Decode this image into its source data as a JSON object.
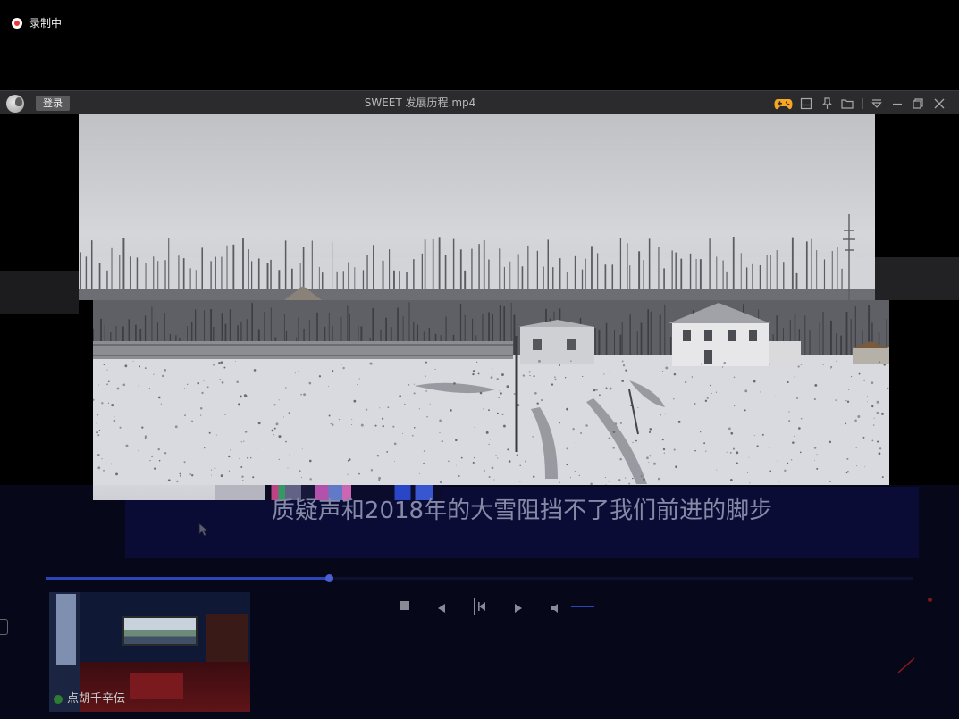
{
  "recording_indicator": {
    "label": "录制中",
    "color": "#e53935"
  },
  "titlebar": {
    "login_label": "登录",
    "title": "SWEET 发展历程.mp4",
    "icons": [
      "gamepad-icon",
      "mini-player-icon",
      "pin-icon",
      "folder-icon",
      "menu-icon",
      "minimize-icon",
      "restore-icon",
      "close-icon"
    ],
    "gamepad_color": "#f5a623"
  },
  "subtitle": {
    "text": "质疑声和2018年的大雪阻挡不了我们前进的脚步"
  },
  "player": {
    "progress": 0.326,
    "volume": 1.0,
    "accent_color": "#2f45b5",
    "controls": [
      "stop-icon",
      "prev-icon",
      "play-pause-icon",
      "next-icon",
      "volume-icon"
    ]
  },
  "preview_thumbnail": {
    "caption": "点胡千辛伝"
  }
}
